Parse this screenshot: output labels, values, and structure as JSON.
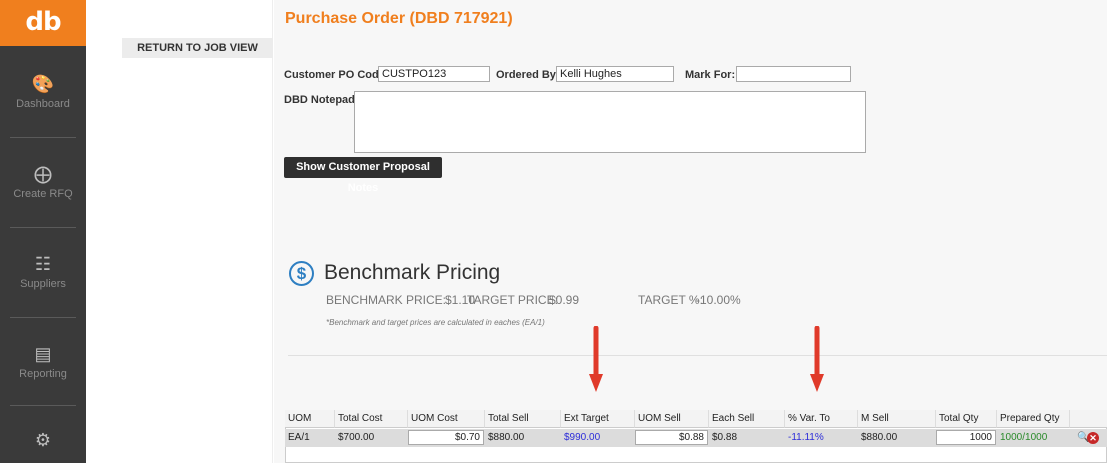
{
  "sidebar": {
    "logo": "db",
    "items": [
      {
        "label": "Dashboard",
        "icon": "palette-icon"
      },
      {
        "label": "Create RFQ",
        "icon": "plus-circle-icon"
      },
      {
        "label": "Suppliers",
        "icon": "hierarchy-icon"
      },
      {
        "label": "Reporting",
        "icon": "bar-chart-icon"
      },
      {
        "label": "",
        "icon": "gears-icon"
      }
    ]
  },
  "subnav": {
    "return_label": "RETURN TO JOB VIEW"
  },
  "page": {
    "title": "Purchase Order (DBD 717921)"
  },
  "form": {
    "po_code_label": "Customer PO Code:",
    "po_code_value": "CUSTPO123",
    "ordered_by_label": "Ordered By:",
    "ordered_by_value": "Kelli Hughes",
    "mark_for_label": "Mark For:",
    "mark_for_value": "",
    "notepad_label": "DBD Notepad:",
    "notepad_value": "",
    "proposal_button": "Show Customer Proposal Notes"
  },
  "benchmark": {
    "icon": "dollar-circle-icon",
    "title": "Benchmark Pricing",
    "benchmark_label": "BENCHMARK PRICE:",
    "benchmark_value": "$1.10",
    "target_label": "TARGET PRICE:",
    "target_value": "$0.99",
    "target_pct_label": "TARGET %:",
    "target_pct_value": "-10.00%",
    "note": "*Benchmark and target prices are calculated in eaches (EA/1)"
  },
  "table": {
    "headers": [
      "UOM",
      "Total Cost",
      "UOM Cost",
      "Total Sell",
      "Ext Target Price",
      "UOM Sell",
      "Each Sell",
      "% Var. To Targ...",
      "M Sell",
      "Total Qty",
      "Prepared Qty"
    ],
    "row": {
      "uom": "EA/1",
      "total_cost": "$700.00",
      "uom_cost": "$0.70",
      "total_sell": "$880.00",
      "ext_target_price": "$990.00",
      "uom_sell": "$0.88",
      "each_sell": "$0.88",
      "var_to_target": "-11.11%",
      "m_sell": "$880.00",
      "total_qty": "1000",
      "prepared_qty": "1000/1000"
    },
    "row_actions": {
      "search_icon": "search-icon",
      "remove_icon": "close-icon",
      "remove_glyph": "✕"
    }
  },
  "colors": {
    "accent": "#f07f1e",
    "sidebar": "#3a3a3a",
    "link_blue": "#2d2dd9",
    "ok_green": "#2a8a2a",
    "arrow_red": "#e03a2a"
  }
}
